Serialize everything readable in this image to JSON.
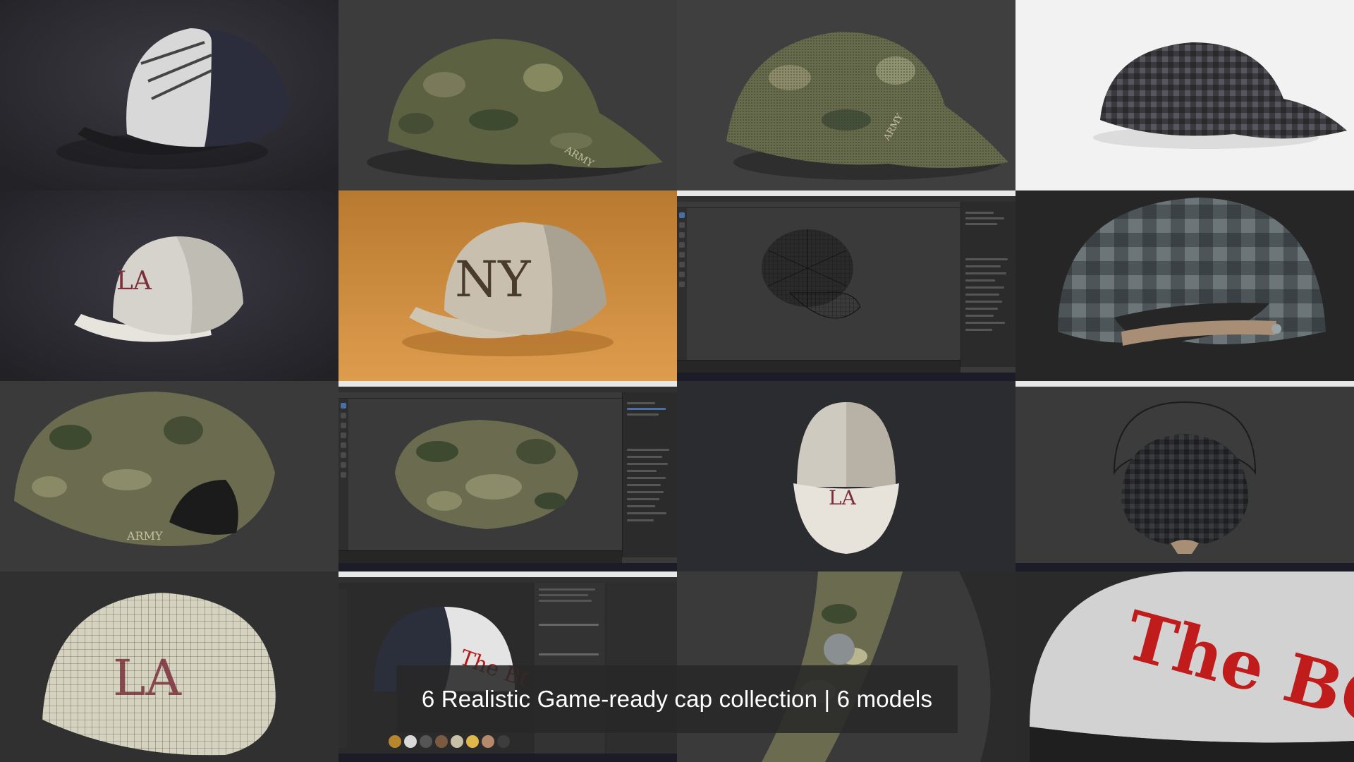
{
  "caption": {
    "text": "6 Realistic Game-ready cap collection | 6 models"
  },
  "tiles": [
    {
      "subject": "cap-white-black-claw",
      "background": "#2e2d33"
    },
    {
      "subject": "cap-camo-army",
      "background": "#3c3c3c"
    },
    {
      "subject": "cap-camo-mesh-army",
      "background": "#3f3f3f"
    },
    {
      "subject": "cap-plaid-dark",
      "background": "#f2f2f2"
    },
    {
      "subject": "cap-white-la-mesh",
      "background": "#2c2b32"
    },
    {
      "subject": "cap-ny-beige-mesh",
      "background": "#c98a3e"
    },
    {
      "subject": "blender-wireframe-cap",
      "background": "#3a3a3a"
    },
    {
      "subject": "cap-plaid-leather-strap",
      "background": "#262626"
    },
    {
      "subject": "cap-camo-back-army",
      "background": "#3a3a3a"
    },
    {
      "subject": "blender-camo-cap",
      "background": "#3a3a3a"
    },
    {
      "subject": "cap-white-la-top",
      "background": "#2b2c30"
    },
    {
      "subject": "blender-plaid-cap-back",
      "background": "#3a3a3a"
    },
    {
      "subject": "cap-la-wireframe",
      "background": "#303030"
    },
    {
      "subject": "substance-painter-boss-cap",
      "background": "#2b2b2b"
    },
    {
      "subject": "camo-strap-closeup",
      "background": "#3a3a3a"
    },
    {
      "subject": "cap-boss-closeup",
      "background": "#2a2a2a"
    }
  ],
  "visible_text": {
    "army_label": "ARMY",
    "boss_label": "The BOS",
    "ny_logo": "NY",
    "la_logo": "LA"
  }
}
